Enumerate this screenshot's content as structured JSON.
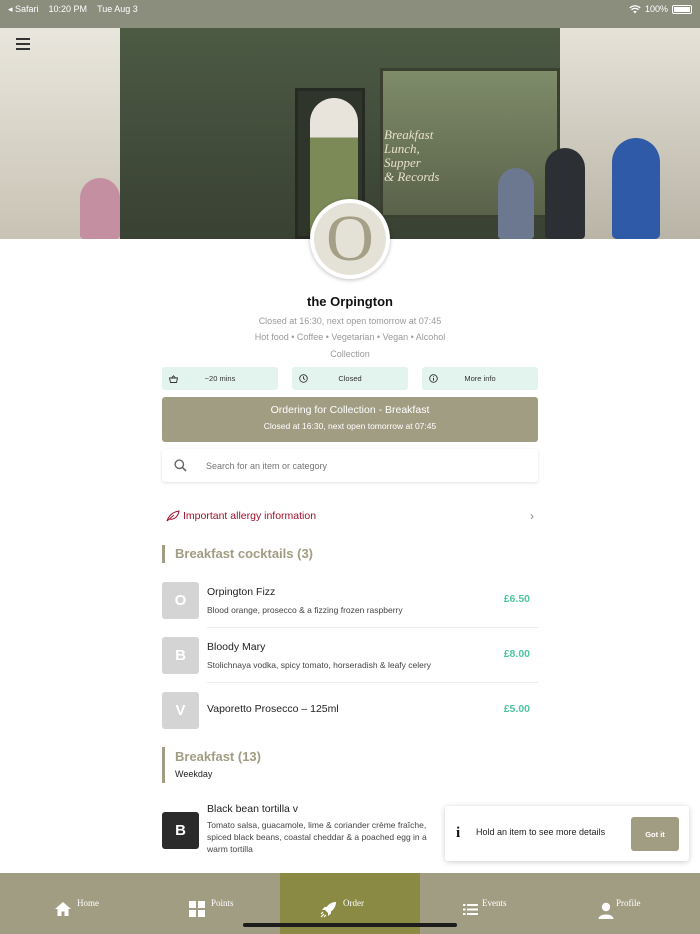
{
  "status_bar": {
    "back_app": "◂ Safari",
    "time": "10:20 PM",
    "date": "Tue Aug 3",
    "battery": "100%"
  },
  "hero": {
    "window_sign": [
      "Breakfast",
      "Lunch,",
      "Supper",
      "& Records"
    ]
  },
  "venue": {
    "logo_letter": "O",
    "name": "the Orpington",
    "opening_status": "Closed at 16:30, next open tomorrow at 07:45",
    "tags": "Hot food • Coffee • Vegetarian • Vegan • Alcohol",
    "mode": "Collection"
  },
  "chips": [
    {
      "icon": "basket-icon",
      "label": "~20 mins"
    },
    {
      "icon": "clock-icon",
      "label": "Closed"
    },
    {
      "icon": "info-icon",
      "label": "More info"
    }
  ],
  "order_banner": {
    "title": "Ordering for Collection - Breakfast",
    "subtitle": "Closed at 16:30, next open tomorrow at 07:45"
  },
  "search": {
    "placeholder": "Search for an item or category"
  },
  "allergy": {
    "label": "Important allergy information"
  },
  "sections": [
    {
      "title": "Breakfast cocktails (3)",
      "subtitle": "",
      "items": [
        {
          "thumb": "O",
          "name": "Orpington Fizz",
          "description": "Blood orange, prosecco & a fizzing frozen raspberry",
          "price": "£6.50"
        },
        {
          "thumb": "B",
          "name": "Bloody Mary",
          "description": "Stolichnaya vodka, spicy tomato, horseradish & leafy celery",
          "price": "£8.00"
        },
        {
          "thumb": "V",
          "name": "Vaporetto Prosecco – 125ml",
          "description": "",
          "price": "£5.00"
        }
      ]
    },
    {
      "title": "Breakfast (13)",
      "subtitle": "Weekday",
      "items": [
        {
          "thumb": "B",
          "name": "Black bean tortilla v",
          "description": "Tomato salsa, guacamole, lime & coriander crème fraîche, spiced black beans, coastal cheddar & a poached egg in a warm tortilla",
          "price": ""
        }
      ]
    }
  ],
  "tooltip": {
    "text": "Hold an item to see more details",
    "button": "Got it"
  },
  "tabs": [
    {
      "label": "Home",
      "icon": "home-icon"
    },
    {
      "label": "Points",
      "icon": "grid-icon"
    },
    {
      "label": "Order",
      "icon": "rocket-icon",
      "active": true
    },
    {
      "label": "Events",
      "icon": "list-icon"
    },
    {
      "label": "Profile",
      "icon": "person-icon"
    }
  ],
  "colors": {
    "accent": "#a19d83",
    "price": "#4ec5a0",
    "allergy": "#a0102a",
    "active_tab": "#8a8a45",
    "chip_bg": "#e3f4ee"
  }
}
